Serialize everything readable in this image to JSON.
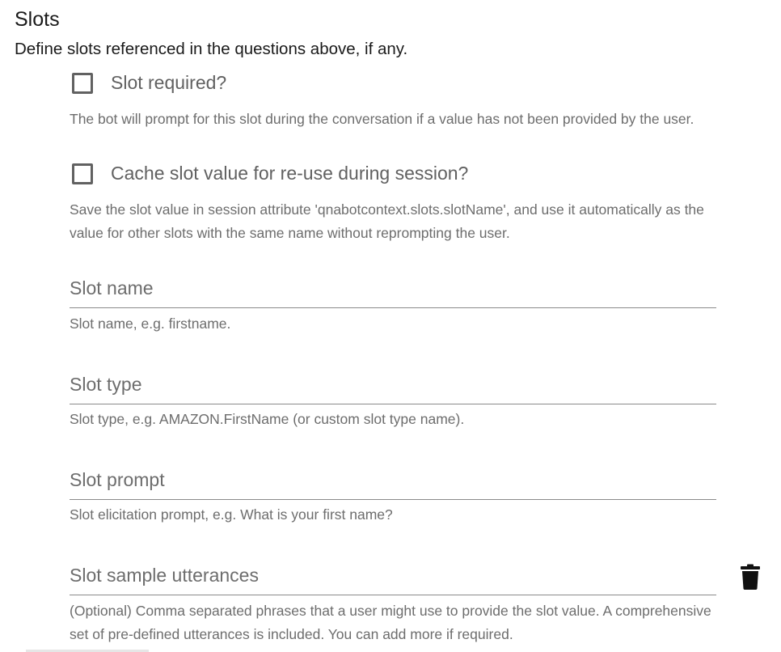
{
  "section": {
    "title": "Slots",
    "description": "Define slots referenced in the questions above, if any."
  },
  "checkboxes": [
    {
      "label": "Slot required?",
      "checked": false,
      "hint": "The bot will prompt for this slot during the conversation if a value has not been provided by the user."
    },
    {
      "label": "Cache slot value for re-use during session?",
      "checked": false,
      "hint": "Save the slot value in session attribute 'qnabotcontext.slots.slotName', and use it automatically as the value for other slots with the same name without reprompting the user."
    }
  ],
  "fields": [
    {
      "label": "Slot name",
      "hint": "Slot name, e.g. firstname."
    },
    {
      "label": "Slot type",
      "hint": "Slot type, e.g. AMAZON.FirstName (or custom slot type name)."
    },
    {
      "label": "Slot prompt",
      "hint": "Slot elicitation prompt, e.g. What is your first name?"
    },
    {
      "label": "Slot sample utterances",
      "hint": "(Optional) Comma separated phrases that a user might use to provide the slot value. A comprehensive set of pre-defined utterances is included. You can add more if required."
    }
  ],
  "icons": {
    "delete": "trash-icon"
  }
}
